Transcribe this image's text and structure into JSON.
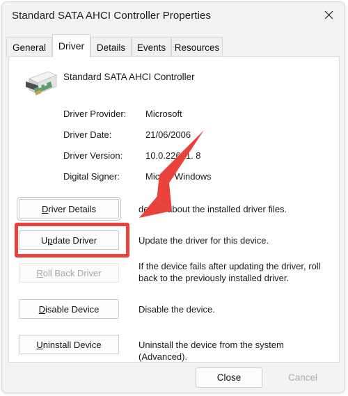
{
  "window": {
    "title": "Standard SATA AHCI Controller Properties",
    "close_icon": "close-icon"
  },
  "tabs": [
    {
      "label": "General",
      "active": false
    },
    {
      "label": "Driver",
      "active": true
    },
    {
      "label": "Details",
      "active": false
    },
    {
      "label": "Events",
      "active": false
    },
    {
      "label": "Resources",
      "active": false
    }
  ],
  "device": {
    "name": "Standard SATA AHCI Controller",
    "icon": "pci-controller-card-icon"
  },
  "driver_info": [
    {
      "label": "Driver Provider:",
      "value": "Microsoft"
    },
    {
      "label": "Driver Date:",
      "value": "21/06/2006"
    },
    {
      "label": "Driver Version:",
      "value": "10.0.22621.  8"
    },
    {
      "label": "Digital Signer:",
      "value": "Micros    Windows"
    }
  ],
  "actions": [
    {
      "label": "Driver Details",
      "accel": "D",
      "description": "details about the installed driver files.",
      "disabled": false,
      "focused": true,
      "highlighted": false
    },
    {
      "label": "Update Driver",
      "accel": "p",
      "description": "Update the driver for this device.",
      "disabled": false,
      "focused": false,
      "highlighted": true
    },
    {
      "label": "Roll Back Driver",
      "accel": "R",
      "description": "If the device fails after updating the driver, roll back to the previously installed driver.",
      "disabled": true,
      "focused": false,
      "highlighted": false
    },
    {
      "label": "Disable Device",
      "accel": "D",
      "description": "Disable the device.",
      "disabled": false,
      "focused": false,
      "highlighted": false
    },
    {
      "label": "Uninstall Device",
      "accel": "U",
      "description": "Uninstall the device from the system (Advanced).",
      "disabled": false,
      "focused": false,
      "highlighted": false
    }
  ],
  "footer": {
    "close_label": "Close",
    "cancel_label": "Cancel"
  },
  "annotations": {
    "highlight_color": "#e8423a",
    "arrow_color": "#e8423a",
    "arrow_name": "red-pointer-arrow",
    "highlight_target": "Update Driver"
  }
}
